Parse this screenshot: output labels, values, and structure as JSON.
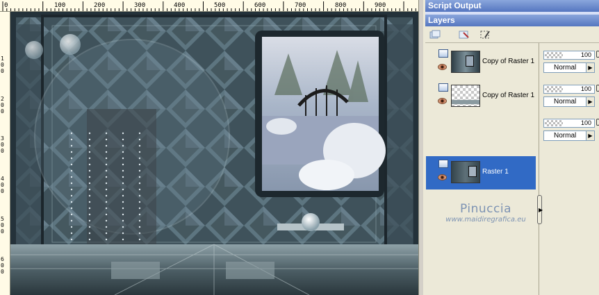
{
  "panels": {
    "script_output_title": "Script Output",
    "layers_title": "Layers"
  },
  "ruler": {
    "top_labels": [
      "0",
      "100",
      "200",
      "300",
      "400",
      "500",
      "600",
      "700",
      "800",
      "900"
    ],
    "left_labels": [
      "1\n0\n0",
      "2\n0\n0",
      "3\n0\n0",
      "4\n0\n0",
      "5\n0\n0",
      "6\n0\n0"
    ]
  },
  "layers": [
    {
      "name": "Copy of Raster 1",
      "opacity": "100",
      "blend_mode": "Normal",
      "selected": false
    },
    {
      "name": "Copy of Raster 1",
      "opacity": "100",
      "blend_mode": "Normal",
      "selected": false
    },
    {
      "name": "Raster 1",
      "opacity": "100",
      "blend_mode": "Normal",
      "selected": true
    }
  ],
  "watermark": {
    "name": "Pinuccia",
    "site": "www.maidiregrafica.eu"
  },
  "colors": {
    "selection": "#316ac5",
    "titlebar": "#6a88cc",
    "panel_bg": "#ece9d8"
  },
  "icons": {
    "new_layer": "new-layer-icon",
    "delete_layer": "delete-layer-icon",
    "edit_selection": "edit-selection-icon",
    "visibility": "eye-icon",
    "layer_type": "raster-layer-icon"
  }
}
